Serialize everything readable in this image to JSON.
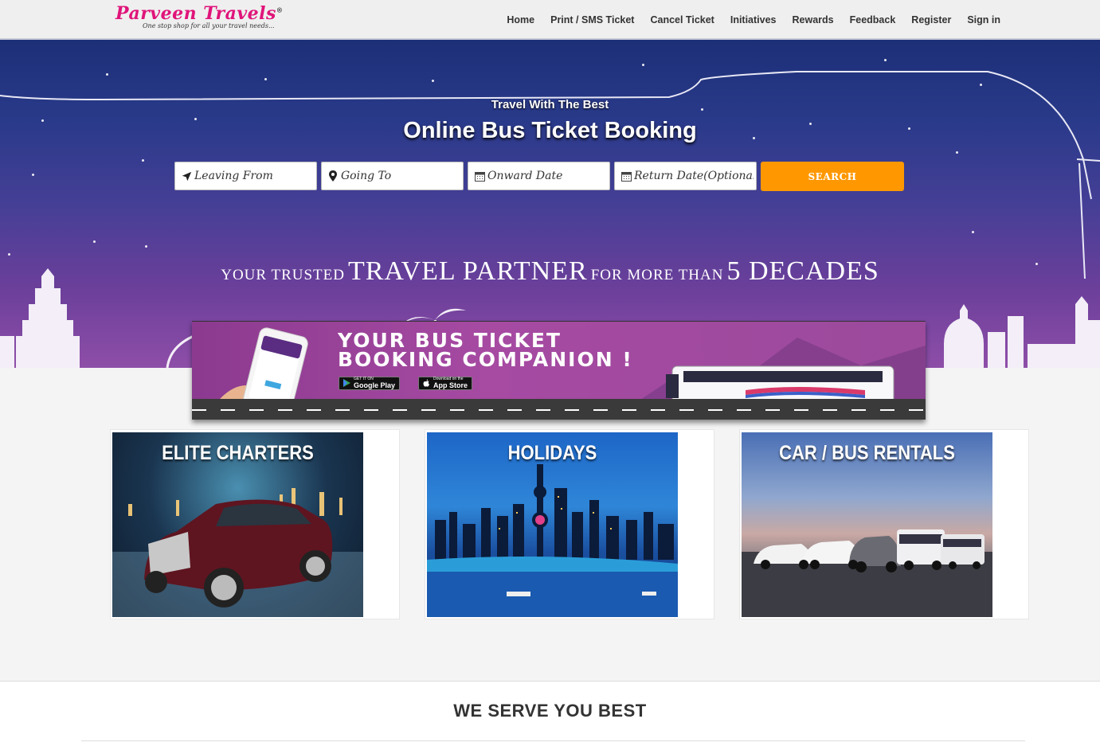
{
  "header": {
    "logo_name": "Parveen Travels",
    "logo_tagline": "One stop shop for all your travel needs...",
    "nav": [
      "Home",
      "Print / SMS Ticket",
      "Cancel Ticket",
      "Initiatives",
      "Rewards",
      "Feedback",
      "Register",
      "Sign in"
    ]
  },
  "hero": {
    "kicker": "Travel With The Best",
    "title": "Online Bus Ticket Booking",
    "search": {
      "from_placeholder": "Leaving From",
      "to_placeholder": "Going To",
      "onward_placeholder": "Onward Date",
      "return_placeholder": "Return Date(Optional)",
      "button_label": "SEARCH"
    },
    "tagline": {
      "part1": "YOUR TRUSTED",
      "part2": "TRAVEL PARTNER",
      "part3": "FOR MORE THAN",
      "part4": "5 DECADES"
    }
  },
  "app_banner": {
    "line1": "YOUR BUS TICKET",
    "line2": "BOOKING COMPANION !",
    "google_small": "GET IT ON",
    "google_label": "Google Play",
    "apple_small": "Download on the",
    "apple_label": "App Store"
  },
  "cards": [
    {
      "title": "ELITE CHARTERS"
    },
    {
      "title": "HOLIDAYS"
    },
    {
      "title": "CAR / BUS RENTALS"
    }
  ],
  "section": {
    "title": "WE SERVE YOU BEST"
  },
  "colors": {
    "brand_pink": "#e0147a",
    "search_orange": "#ff9800",
    "hero_top": "#1c2f77",
    "hero_bottom": "#8e4ea8"
  }
}
